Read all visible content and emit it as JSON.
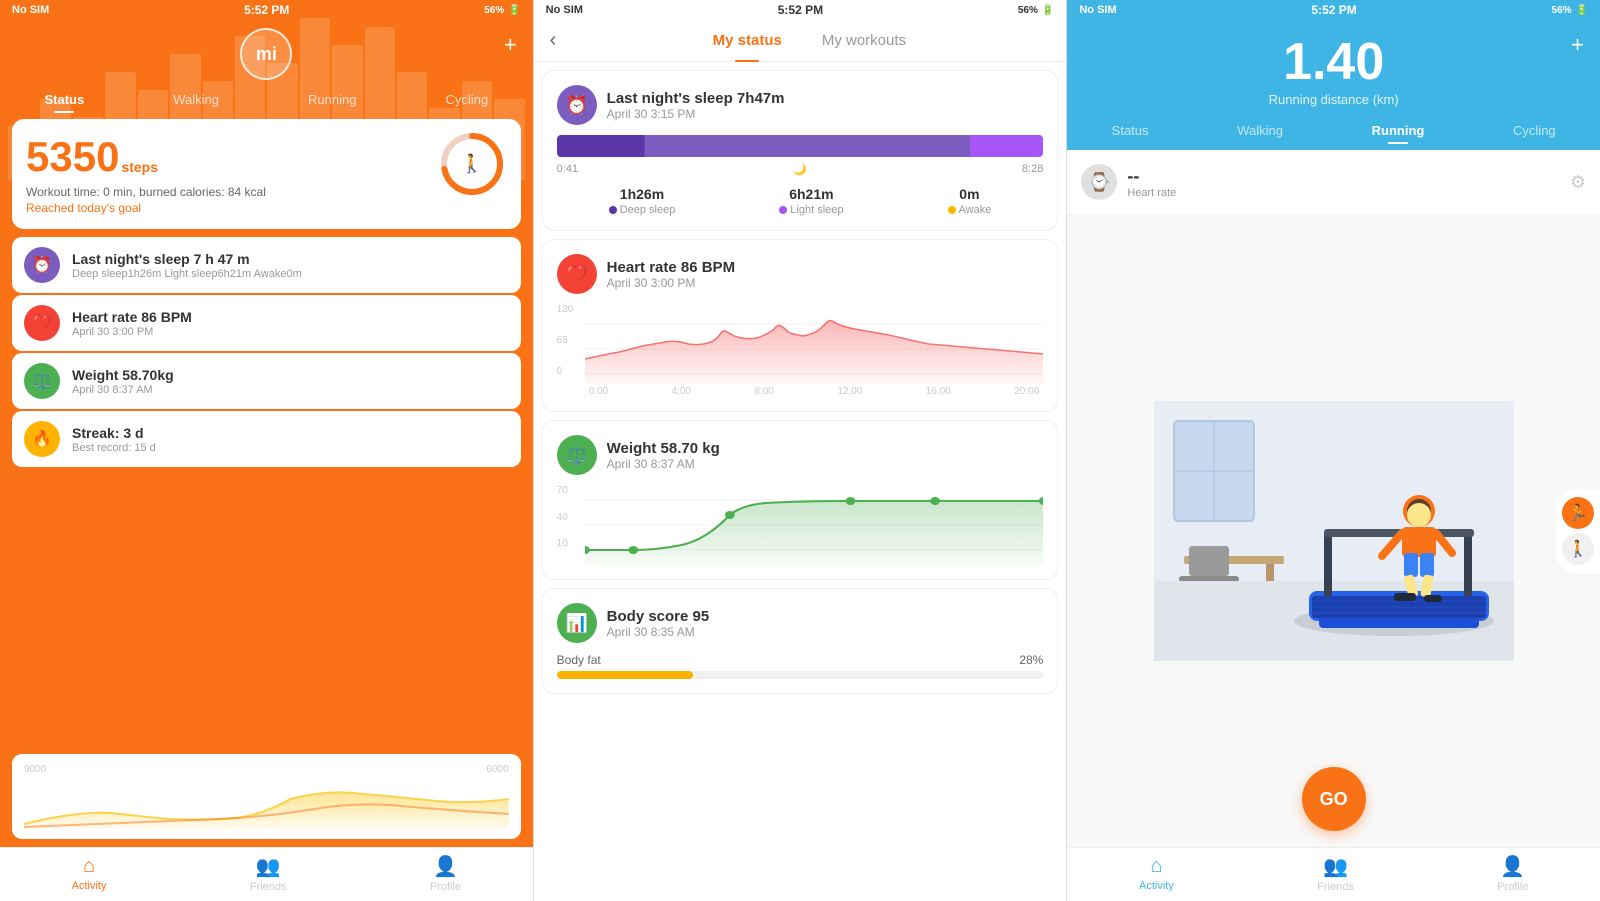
{
  "statusBar": {
    "carrier": "No SIM",
    "time": "5:52 PM",
    "battery": "56%"
  },
  "leftPanel": {
    "logoText": "mi",
    "tabs": [
      "Status",
      "Walking",
      "Running",
      "Cycling"
    ],
    "activeTab": "Status",
    "steps": "5350",
    "stepsSmall": "steps",
    "workoutInfo": "Workout time: 0 min, burned calories: 84 kcal",
    "goalText": "Reached today's goal",
    "ringProgress": 72,
    "activities": [
      {
        "icon": "sleep",
        "title": "Last night's sleep 7 h 47 m",
        "sub": "Deep sleep1h26m Light sleep6h21m Awake0m"
      },
      {
        "icon": "heart",
        "title": "Heart rate 86 BPM",
        "sub": "April 30 3:00 PM"
      },
      {
        "icon": "weight",
        "title": "Weight 58.70kg",
        "sub": "April 30 8:37 AM"
      },
      {
        "icon": "streak",
        "title": "Streak: 3 d",
        "sub": "Best record: 15 d"
      }
    ],
    "chartLabels": [
      "9000",
      "6000"
    ],
    "bottomNav": [
      {
        "label": "Activity",
        "active": true
      },
      {
        "label": "Friends",
        "active": false
      },
      {
        "label": "Profile",
        "active": false
      }
    ]
  },
  "middlePanel": {
    "backLabel": "‹",
    "tabs": [
      "My status",
      "My workouts"
    ],
    "activeTab": "My status",
    "cards": {
      "sleep": {
        "title": "Last night's sleep 7h47m",
        "sub": "April 30 3:15 PM",
        "timeStart": "0:41",
        "timeMid": "🌙",
        "timeEnd": "8:28",
        "deepSleep": "1h26m",
        "lightSleep": "6h21m",
        "awake": "0m"
      },
      "heartRate": {
        "title": "Heart rate 86  BPM",
        "sub": "April 30 3:00 PM",
        "yLabels": [
          "130",
          "65",
          "0"
        ],
        "xLabels": [
          "0:00",
          "4:00",
          "8:00",
          "12:00",
          "16:00",
          "20:00"
        ]
      },
      "weight": {
        "title": "Weight 58.70 kg",
        "sub": "April 30 8:37 AM",
        "yLabels": [
          "70",
          "40",
          "10"
        ]
      },
      "bodyScore": {
        "title": "Body score 95",
        "sub": "April 30 8:35 AM",
        "bodyFatLabel": "Body fat",
        "bodyFatPercent": "28%",
        "bodyFatProgress": 28
      }
    }
  },
  "rightPanel": {
    "distanceVal": "1.40",
    "distanceLabel": "Running distance (km)",
    "tabs": [
      "Status",
      "Walking",
      "Running",
      "Cycling"
    ],
    "activeTab": "Running",
    "heartRate": {
      "val": "--",
      "label": "Heart rate"
    },
    "goLabel": "GO",
    "bottomNav": [
      {
        "label": "Activity",
        "active": true
      },
      {
        "label": "Friends",
        "active": false
      },
      {
        "label": "Profile",
        "active": false
      }
    ]
  }
}
